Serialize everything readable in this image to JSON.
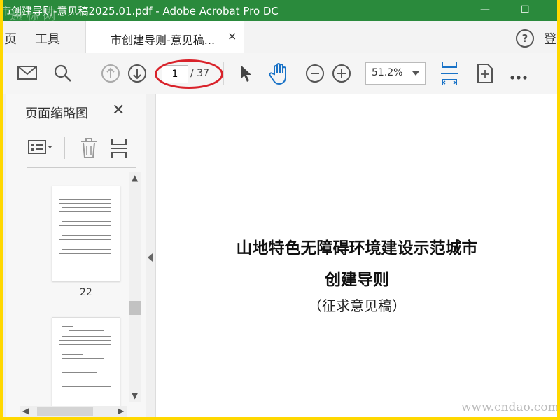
{
  "window": {
    "title": "市创建导则-意见稿2025.01.pdf - Adobe Acrobat Pro DC",
    "watermark": "通 标 网",
    "minimize": "—",
    "maximize": "☐"
  },
  "tabbar": {
    "menu_home": "页",
    "menu_tools": "工具",
    "doc_tab_label": "市创建导则-意见稿...",
    "doc_tab_close": "×",
    "help": "?",
    "signin": "登"
  },
  "toolbar": {
    "current_page": "1",
    "total_pages": "/ 37",
    "zoom": "51.2%"
  },
  "panel": {
    "title": "页面缩略图",
    "close": "✕",
    "thumb_page_label": "22"
  },
  "document": {
    "title_line1": "山地特色无障碍环境建设示范城市",
    "title_line2": "创建导则",
    "subtitle": "（征求意见稿）"
  },
  "corner_watermark": "www.cndao.com"
}
